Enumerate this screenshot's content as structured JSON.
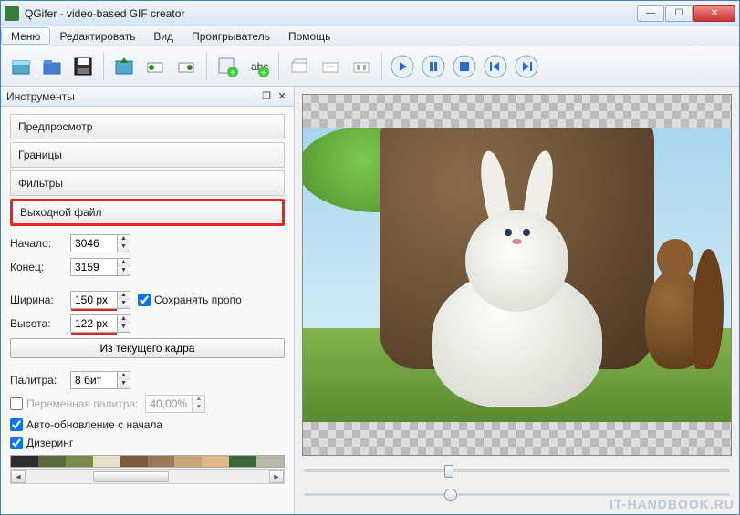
{
  "window": {
    "title": "QGifer - video-based GIF creator"
  },
  "menu": {
    "items": [
      "Меню",
      "Редактировать",
      "Вид",
      "Проигрыватель",
      "Помощь"
    ],
    "selected": 0
  },
  "panel": {
    "title": "Инструменты",
    "sections": {
      "preview": "Предпросмотр",
      "borders": "Границы",
      "filters": "Фильтры",
      "output": "Выходной файл"
    }
  },
  "output": {
    "start_label": "Начало:",
    "end_label": "Конец:",
    "width_label": "Ширина:",
    "height_label": "Высота:",
    "start_value": "3046",
    "end_value": "3159",
    "width_value": "150 px",
    "height_value": "122 px",
    "keep_ratio_label": "Сохранять пропо",
    "keep_ratio_checked": true,
    "from_current_frame": "Из текущего кадра",
    "palette_label": "Палитра:",
    "palette_value": "8 бит",
    "variable_palette_label": "Переменная палитра:",
    "variable_palette_value": "40,00%",
    "variable_palette_checked": false,
    "auto_update_label": "Авто-обновление с начала",
    "auto_update_checked": true,
    "dithering_label": "Дизеринг",
    "dithering_checked": true,
    "palette_colors": [
      "#2d2d2d",
      "#5a6a3a",
      "#7a8a4a",
      "#e8e0c8",
      "#7a5a3a",
      "#9a7a5a",
      "#c8a878",
      "#e0b888",
      "#3a6a3a",
      "#b8b8a8"
    ]
  },
  "player": {
    "slider1_pos": 0.33,
    "slider2_pos": 0.33
  },
  "watermark": "IT-HANDBOOK.RU"
}
